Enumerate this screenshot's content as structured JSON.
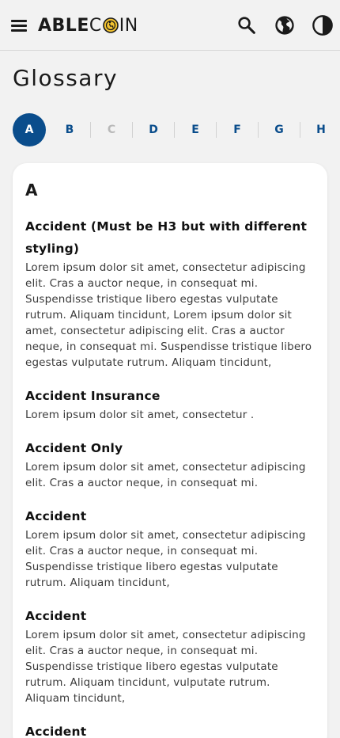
{
  "header": {
    "logo_able": "ABLE",
    "logo_c": "C",
    "logo_in": "IN",
    "icons": [
      "menu-icon",
      "search-icon",
      "globe-icon",
      "dark-mode-icon"
    ]
  },
  "page": {
    "title": "Glossary"
  },
  "alphabet": {
    "letters": [
      {
        "label": "A",
        "state": "active"
      },
      {
        "label": "B",
        "state": "enabled"
      },
      {
        "label": "C",
        "state": "disabled"
      },
      {
        "label": "D",
        "state": "enabled"
      },
      {
        "label": "E",
        "state": "enabled"
      },
      {
        "label": "F",
        "state": "enabled"
      },
      {
        "label": "G",
        "state": "enabled"
      },
      {
        "label": "H",
        "state": "enabled"
      }
    ]
  },
  "section": {
    "letter": "A",
    "entries": [
      {
        "term": "Accident (Must be H3 but with different styling)",
        "definition": "Lorem ipsum dolor sit amet, consectetur adipiscing elit. Cras a auctor neque, in consequat mi. Suspendisse tristique libero egestas vulputate rutrum. Aliquam tincidunt, Lorem ipsum dolor sit amet, consectetur adipiscing elit. Cras a auctor neque, in consequat mi. Suspendisse tristique libero egestas vulputate rutrum. Aliquam tincidunt,"
      },
      {
        "term": "Accident Insurance",
        "definition": "Lorem ipsum dolor sit amet, consectetur ."
      },
      {
        "term": "Accident Only",
        "definition": "Lorem ipsum dolor sit amet, consectetur adipiscing elit. Cras a auctor neque, in consequat mi."
      },
      {
        "term": "Accident",
        "definition": "Lorem ipsum dolor sit amet, consectetur adipiscing elit. Cras a auctor neque, in consequat mi. Suspendisse tristique libero egestas vulputate rutrum. Aliquam tincidunt,"
      },
      {
        "term": "Accident",
        "definition": "Lorem ipsum dolor sit amet, consectetur adipiscing elit. Cras a auctor neque, in consequat mi. Suspendisse tristique libero egestas vulputate rutrum. Aliquam tincidunt,  vulputate rutrum. Aliquam tincidunt,"
      },
      {
        "term": "Accident",
        "definition": ""
      }
    ]
  },
  "colors": {
    "accent": "#0a4d8c",
    "background": "#f2f2f2",
    "card": "#ffffff",
    "disabled": "#b9b9b9"
  }
}
